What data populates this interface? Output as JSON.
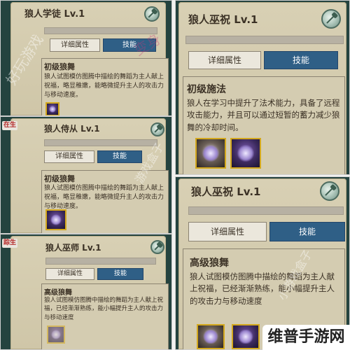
{
  "tabs": {
    "detail": "详细属性",
    "skill": "技能"
  },
  "panels": [
    {
      "title": "狼人学徒 Lv.1",
      "skill_name": "初级狼舞",
      "desc": "狼人试图模仿图腾中描绘的舞蹈为主人献上祝福，略显稚嫩，能略微提升主人的攻击力与移动速度。",
      "badge": ""
    },
    {
      "title": "狼人巫祝 Lv.1",
      "skill_name": "初级施法",
      "desc": "狼人在学习中提升了法术能力，具备了远程攻击能力，并且可以通过短暂的蓄力减少狼舞的冷却时间。",
      "badge": ""
    },
    {
      "title": "狼人侍从 Lv.1",
      "skill_name": "初级狼舞",
      "desc": "狼人试图模仿图腾中描绘的舞蹈为主人献上祝福，略显稚嫩，能略微提升主人的攻击力与移动速度。",
      "badge": "在生"
    },
    {
      "title": "狼人巫祝 Lv.1",
      "skill_name": "高级狼舞",
      "desc": "狼人试图模仿图腾中描绘的舞蹈为主人献上祝福，已经渐渐熟练，能小幅提升主人的攻击力与移动速度",
      "badge": ""
    },
    {
      "title": "狼人巫师 Lv.1",
      "skill_name": "高级狼舞",
      "desc": "狼人试图模仿图腾中描绘的舞蹈为主人献上祝福，已经渐渐熟练，能小幅提升主人的攻击力与移动速度",
      "badge": "踪生"
    }
  ],
  "brand": "维普手游网",
  "watermarks": {
    "left": "好玩游戏",
    "mid": "游戏盒子",
    "pink": "变身",
    "right": "小游戏盒子"
  },
  "colors": {
    "tab_active": "#2f5f86",
    "panel_bg": "#24433f",
    "paper": "#d8d0b4",
    "icon_border": "#d3a81e"
  }
}
